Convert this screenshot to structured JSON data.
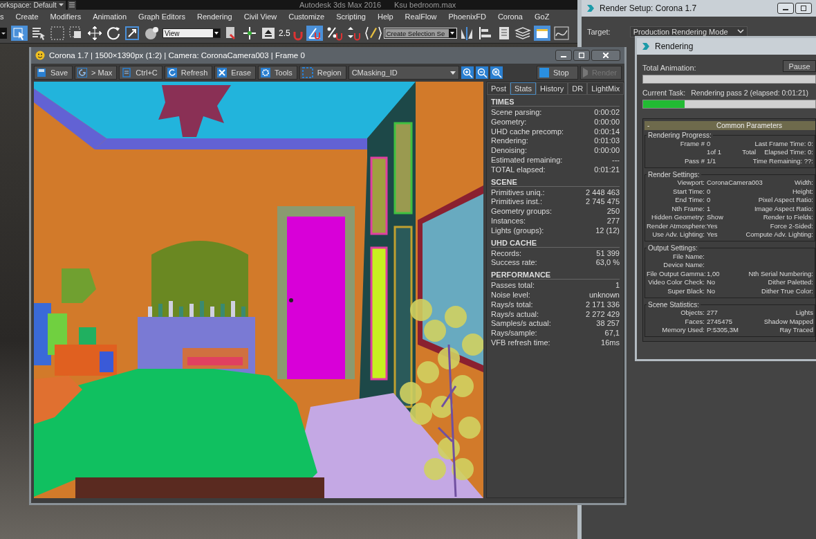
{
  "app": {
    "workspace": "orkspace: Default",
    "title": "Autodesk 3ds Max 2016",
    "file": "Ksu bedroom.max"
  },
  "menu": [
    "s",
    "Create",
    "Modifiers",
    "Animation",
    "Graph Editors",
    "Rendering",
    "Civil View",
    "Customize",
    "Scripting",
    "Help",
    "RealFlow",
    "PhoenixFD",
    "Corona",
    "GoZ"
  ],
  "toolbar": {
    "view_dropdown": "View",
    "snap_label": "2.5",
    "selection_set": "Create Selection Se"
  },
  "vfb": {
    "title": "Corona 1.7 | 1500×1390px (1:2) | Camera: CoronaCamera003 | Frame 0",
    "buttons": [
      {
        "label": "Save",
        "kind": "save"
      },
      {
        "label": "> Max",
        "kind": "max"
      },
      {
        "label": "Ctrl+C",
        "kind": "copy"
      },
      {
        "label": "Refresh",
        "kind": "refresh"
      },
      {
        "label": "Erase",
        "kind": "erase"
      },
      {
        "label": "Tools",
        "kind": "tools"
      },
      {
        "label": "Region",
        "kind": "region"
      }
    ],
    "channel": "CMasking_ID",
    "stop": "Stop",
    "render": {
      "label": "Render",
      "disabled": true
    },
    "tabs": [
      {
        "label": "Post",
        "selected": false
      },
      {
        "label": "Stats",
        "selected": true
      },
      {
        "label": "History",
        "selected": false
      },
      {
        "label": "DR",
        "selected": false
      },
      {
        "label": "LightMix",
        "selected": false
      }
    ],
    "stats": [
      {
        "title": "TIMES",
        "rows": [
          {
            "label": "Scene parsing:",
            "value": "0:00:02"
          },
          {
            "label": "Geometry:",
            "value": "0:00:00"
          },
          {
            "label": "UHD cache precomp:",
            "value": "0:00:14"
          },
          {
            "label": "Rendering:",
            "value": "0:01:03"
          },
          {
            "label": "Denoising:",
            "value": "0:00:00"
          },
          {
            "label": "Estimated remaining:",
            "value": "---"
          },
          {
            "label": "TOTAL elapsed:",
            "value": "0:01:21"
          }
        ]
      },
      {
        "title": "SCENE",
        "rows": [
          {
            "label": "Primitives uniq.:",
            "value": "2 448 463"
          },
          {
            "label": "Primitives inst.:",
            "value": "2 745 475"
          },
          {
            "label": "Geometry groups:",
            "value": "250"
          },
          {
            "label": "Instances:",
            "value": "277"
          },
          {
            "label": "Lights (groups):",
            "value": "12 (12)"
          }
        ]
      },
      {
        "title": "UHD CACHE",
        "rows": [
          {
            "label": "Records:",
            "value": "51 399"
          },
          {
            "label": "Success rate:",
            "value": "63,0 %"
          }
        ]
      },
      {
        "title": "PERFORMANCE",
        "rows": [
          {
            "label": "Passes total:",
            "value": "1"
          },
          {
            "label": "Noise level:",
            "value": "unknown"
          },
          {
            "label": "Rays/s total:",
            "value": "2 171 336"
          },
          {
            "label": "Rays/s actual:",
            "value": "2 272 429"
          },
          {
            "label": "Samples/s actual:",
            "value": "38 257"
          },
          {
            "label": "Rays/sample:",
            "value": "67,1"
          },
          {
            "label": "VFB refresh time:",
            "value": "16ms"
          }
        ]
      }
    ]
  },
  "render_setup": {
    "title": "Render Setup: Corona 1.7",
    "target_label": "Target:",
    "target_value": "Production Rendering Mode"
  },
  "rendering": {
    "title": "Rendering",
    "total_label": "Total Animation:",
    "pause": "Pause",
    "total_bar": {
      "level": 0
    },
    "task_label": "Current Task:",
    "task": "Rendering pass 2 (elapsed: 0:01:21)",
    "task_bar": {
      "level": 0.24
    },
    "rollout_sign": "-",
    "rollout": "Common Parameters",
    "groups": [
      {
        "title": "Rendering Progress:",
        "rows": [
          {
            "label": "Frame #",
            "value": "0",
            "right": "Last Frame Time: 0:"
          },
          {
            "value": "1of 1",
            "middle": "Total",
            "right": "Elapsed Time: 0:"
          },
          {
            "label": "Pass #",
            "value": "1/1",
            "right": "Time Remaining: ??:"
          }
        ]
      },
      {
        "title": "Render Settings:",
        "rows": [
          {
            "label": "Viewport:",
            "value": "CoronaCamera003",
            "right": "Width:"
          },
          {
            "label": "Start Time:",
            "value": "0",
            "right": "Height:"
          },
          {
            "label": "End Time:",
            "value": "0",
            "right": "Pixel Aspect Ratio:"
          },
          {
            "label": "Nth Frame:",
            "value": "1",
            "right": "Image Aspect Ratio:"
          },
          {
            "label": "Hidden Geometry:",
            "value": "Show",
            "right": "Render to Fields:"
          },
          {
            "label": "Render Atmosphere:",
            "value": "Yes",
            "right": "Force 2-Sided:"
          },
          {
            "label": "Use Adv. Lighting:",
            "value": "Yes",
            "right": "Compute Adv. Lighting:"
          }
        ]
      },
      {
        "title": "Output Settings:",
        "rows": [
          {
            "label": "File Name:"
          },
          {
            "label": "Device Name:"
          },
          {
            "label": "File Output Gamma:",
            "value": "1,00",
            "right": "Nth Serial Numbering:"
          },
          {
            "label": "Video Color Check:",
            "value": "No",
            "right": "Dither Paletted:"
          },
          {
            "label": "Super Black:",
            "value": "No",
            "right": "Dither True Color:"
          }
        ]
      },
      {
        "title": "Scene Statistics:",
        "rows": [
          {
            "label": "Objects:",
            "value": "277",
            "right": "Lights"
          },
          {
            "label": "Faces:",
            "value": "2745475",
            "right": "Shadow Mapped"
          },
          {
            "label": "Memory Used:",
            "value": "P:5305,3M",
            "right": "Ray Traced"
          }
        ]
      }
    ]
  }
}
